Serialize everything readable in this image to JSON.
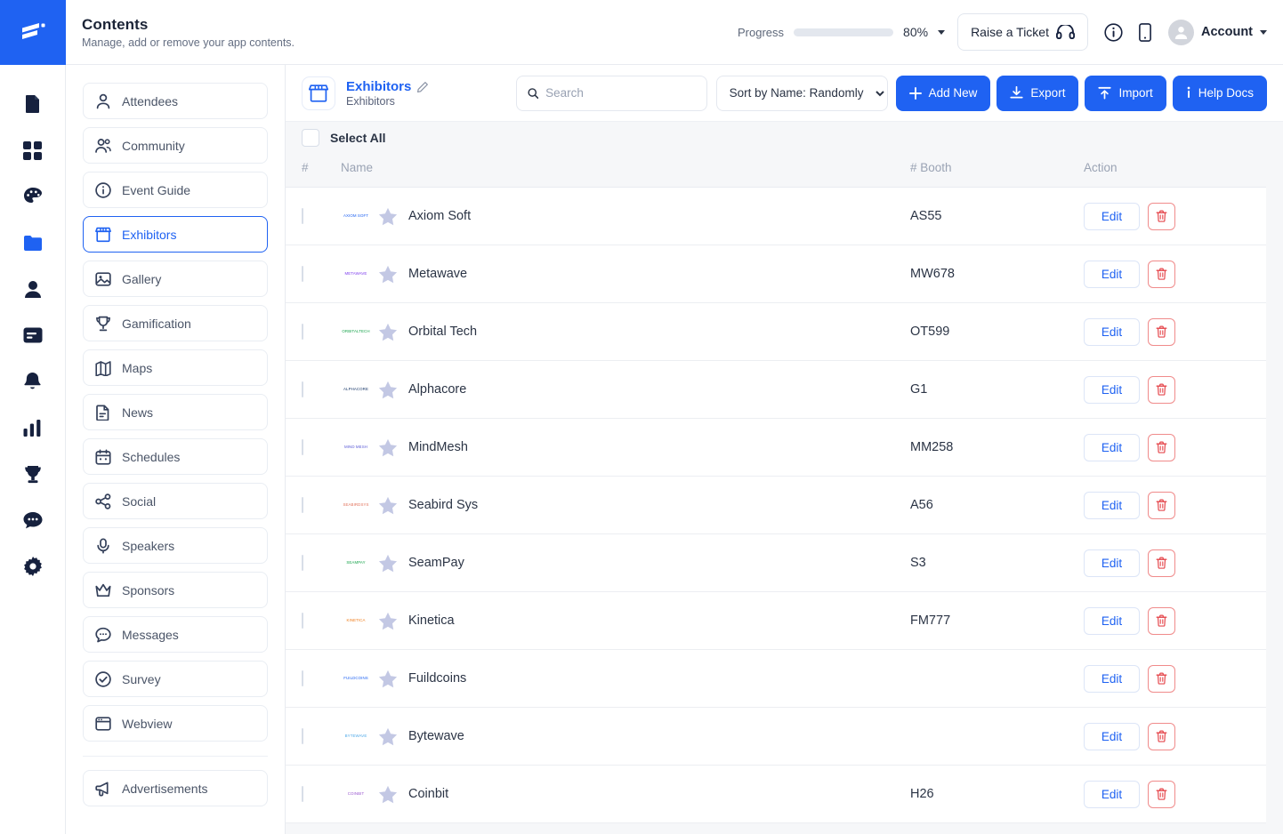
{
  "brand": {
    "accent": "#1f62f2",
    "danger": "#e5484d",
    "logo_icon": "app-logo-icon"
  },
  "rail": {
    "items": [
      {
        "name": "documents-icon",
        "active": false
      },
      {
        "name": "dashboard-grid-icon",
        "active": false
      },
      {
        "name": "palette-icon",
        "active": false
      },
      {
        "name": "folder-icon",
        "active": true
      },
      {
        "name": "person-icon",
        "active": false
      },
      {
        "name": "card-icon",
        "active": false
      },
      {
        "name": "bell-icon",
        "active": false
      },
      {
        "name": "bar-chart-icon",
        "active": false
      },
      {
        "name": "trophy-icon",
        "active": false
      },
      {
        "name": "chat-icon",
        "active": false
      },
      {
        "name": "gear-icon",
        "active": false
      }
    ]
  },
  "header": {
    "title": "Contents",
    "subtitle": "Manage, add or remove your app contents.",
    "progress_label": "Progress",
    "progress_percent": 80,
    "progress_text": "80%",
    "raise_ticket_label": "Raise a Ticket",
    "info_icon": "info-circle-icon",
    "mobile_icon": "mobile-phone-icon",
    "account_label": "Account"
  },
  "menu": {
    "items": [
      {
        "label": "Attendees",
        "icon": "person-icon",
        "active": false
      },
      {
        "label": "Community",
        "icon": "people-group-icon",
        "active": false
      },
      {
        "label": "Event Guide",
        "icon": "info-circle-icon",
        "active": false
      },
      {
        "label": "Exhibitors",
        "icon": "storefront-icon",
        "active": true
      },
      {
        "label": "Gallery",
        "icon": "image-icon",
        "active": false
      },
      {
        "label": "Gamification",
        "icon": "trophy-icon",
        "active": false
      },
      {
        "label": "Maps",
        "icon": "map-icon",
        "active": false
      },
      {
        "label": "News",
        "icon": "news-document-icon",
        "active": false
      },
      {
        "label": "Schedules",
        "icon": "calendar-icon",
        "active": false
      },
      {
        "label": "Social",
        "icon": "share-icon",
        "active": false
      },
      {
        "label": "Speakers",
        "icon": "microphone-icon",
        "active": false
      },
      {
        "label": "Sponsors",
        "icon": "crown-icon",
        "active": false
      },
      {
        "label": "Messages",
        "icon": "message-bubble-icon",
        "active": false
      },
      {
        "label": "Survey",
        "icon": "check-circle-icon",
        "active": false
      },
      {
        "label": "Webview",
        "icon": "browser-window-icon",
        "active": false
      }
    ],
    "footer_items": [
      {
        "label": "Advertisements",
        "icon": "megaphone-icon",
        "active": false
      }
    ]
  },
  "toolbar": {
    "entity_title": "Exhibitors",
    "entity_subtitle": "Exhibitors",
    "entity_icon": "storefront-icon",
    "edit_icon": "pencil-icon",
    "search_placeholder": "Search",
    "search_value": "",
    "search_icon": "search-icon",
    "sort_selected": "Sort by Name: Randomly",
    "sort_options": [
      "Sort by Name: Randomly"
    ],
    "add_new_label": "Add New",
    "export_label": "Export",
    "import_label": "Import",
    "help_docs_label": "Help Docs"
  },
  "table": {
    "select_all_label": "Select All",
    "columns": [
      "#",
      "Name",
      "# Booth",
      "Action"
    ],
    "edit_label": "Edit",
    "delete_icon": "trash-icon",
    "rows": [
      {
        "name": "Axiom Soft",
        "booth": "AS55",
        "logo_text": "AXIOM SOFT",
        "logo_color": "#1f62f2"
      },
      {
        "name": "Metawave",
        "booth": "MW678",
        "logo_text": "METAWAVE",
        "logo_color": "#7c3aed"
      },
      {
        "name": "Orbital Tech",
        "booth": "OT599",
        "logo_text": "ORBITALTECH",
        "logo_color": "#16a34a"
      },
      {
        "name": "Alphacore",
        "booth": "G1",
        "logo_text": "ALPHACORE",
        "logo_color": "#1b3a6b"
      },
      {
        "name": "MindMesh",
        "booth": "MM258",
        "logo_text": "MIND MESH",
        "logo_color": "#5b5bd6"
      },
      {
        "name": "Seabird Sys",
        "booth": "A56",
        "logo_text": "SEABIRDSYS",
        "logo_color": "#e2725b"
      },
      {
        "name": "SeamPay",
        "booth": "S3",
        "logo_text": "SEAMPAY",
        "logo_color": "#16a34a"
      },
      {
        "name": "Kinetica",
        "booth": "FM777",
        "logo_text": "KINETICA",
        "logo_color": "#ef7c1a"
      },
      {
        "name": "Fuildcoins",
        "booth": "",
        "logo_text": "FUILDCOINS",
        "logo_color": "#1f62f2"
      },
      {
        "name": "Bytewave",
        "booth": "",
        "logo_text": "BYTEWAVE",
        "logo_color": "#4fa9e8"
      },
      {
        "name": "Coinbit",
        "booth": "H26",
        "logo_text": "COINBIT",
        "logo_color": "#9b59d0"
      }
    ]
  }
}
